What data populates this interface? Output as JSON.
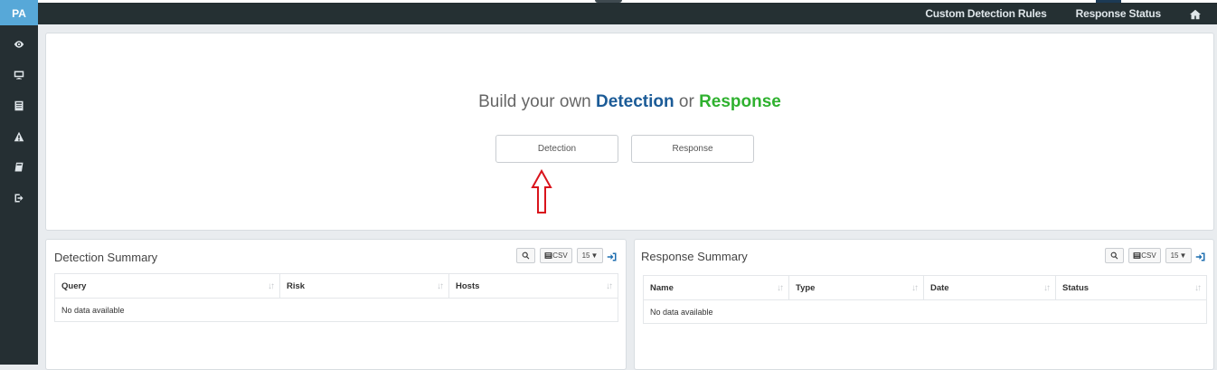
{
  "sidebar": {
    "logo": "PA",
    "items": [
      {
        "icon": "eye-icon"
      },
      {
        "icon": "monitor-icon"
      },
      {
        "icon": "list-icon"
      },
      {
        "icon": "warning-icon"
      },
      {
        "icon": "book-icon"
      },
      {
        "icon": "sign-out-icon"
      }
    ]
  },
  "topbar": {
    "links": [
      "Custom Detection Rules",
      "Response Status"
    ],
    "home_icon": "home-icon"
  },
  "builder": {
    "headline_prefix": "Build your own ",
    "headline_detection": "Detection",
    "headline_or": " or ",
    "headline_response": "Response",
    "detection_button": "Detection",
    "response_button": "Response",
    "arrow_color": "#d9141c"
  },
  "detection_summary": {
    "title": "Detection Summary",
    "csv_label": "CSV",
    "page_size": "15",
    "columns": [
      "Query",
      "Risk",
      "Hosts"
    ],
    "empty_text": "No data available"
  },
  "response_summary": {
    "title": "Response Summary",
    "csv_label": "CSV",
    "page_size": "15",
    "columns": [
      "Name",
      "Type",
      "Date",
      "Status"
    ],
    "empty_text": "No data available"
  },
  "colors": {
    "detection": "#1b5b97",
    "response": "#2fb12f",
    "sidebar": "#252f33",
    "logo_bg": "#57a8d8"
  }
}
